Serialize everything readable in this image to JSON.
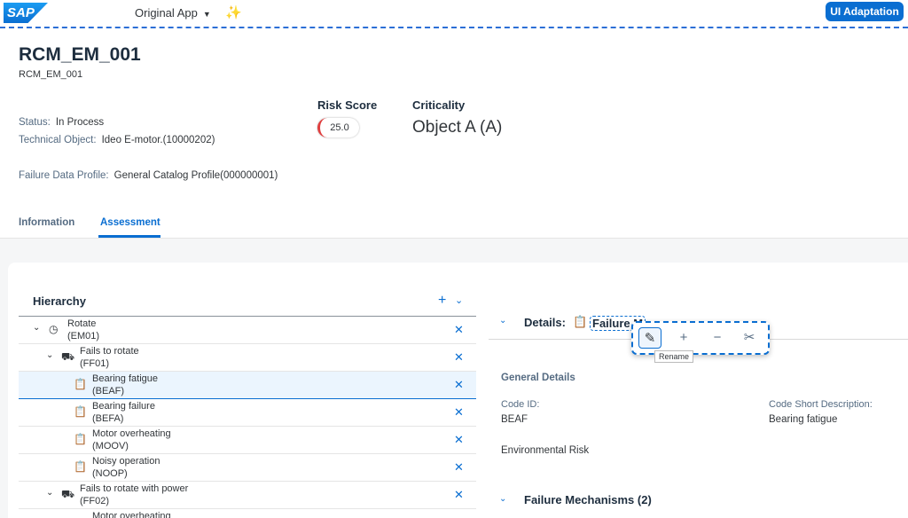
{
  "shell": {
    "logo": "SAP",
    "app_title": "Original App",
    "ui_adaptation": "UI Adaptation"
  },
  "header": {
    "title": "RCM_EM_001",
    "subtitle": "RCM_EM_001",
    "status_label": "Status:",
    "status_value": "In Process",
    "tech_obj_label": "Technical Object:",
    "tech_obj_value": "Ideo E-motor.(10000202)",
    "fdp_label": "Failure Data Profile:",
    "fdp_value": "General Catalog Profile(000000001)",
    "risk_score_label": "Risk Score",
    "risk_score_value": "25.0",
    "criticality_label": "Criticality",
    "criticality_value": "Object A (A)"
  },
  "tabs": [
    {
      "label": "Information",
      "active": false
    },
    {
      "label": "Assessment",
      "active": true
    }
  ],
  "hierarchy": {
    "title": "Hierarchy",
    "rows": [
      {
        "name": "Rotate",
        "code": "(EM01)",
        "level": 0,
        "icon": "gauge-icon",
        "expanded": true
      },
      {
        "name": "Fails to rotate",
        "code": "(FF01)",
        "level": 1,
        "icon": "car-icon",
        "expanded": true
      },
      {
        "name": "Bearing fatigue",
        "code": "(BEAF)",
        "level": 2,
        "icon": "clipboard-icon",
        "selected": true
      },
      {
        "name": "Bearing failure",
        "code": "(BEFA)",
        "level": 2,
        "icon": "clipboard-icon"
      },
      {
        "name": "Motor overheating",
        "code": "(MOOV)",
        "level": 2,
        "icon": "clipboard-icon"
      },
      {
        "name": "Noisy operation",
        "code": "(NOOP)",
        "level": 2,
        "icon": "clipboard-icon"
      },
      {
        "name": "Fails to rotate with power",
        "code": "(FF02)",
        "level": 1,
        "icon": "car-icon",
        "expanded": true
      },
      {
        "name": "Motor overheating",
        "code": "",
        "level": 2,
        "icon": "clipboard-icon"
      }
    ]
  },
  "details": {
    "title": "Details:",
    "subject": "Failure M",
    "tooltip": "Rename",
    "general_title": "General Details",
    "code_id_label": "Code ID:",
    "code_id_value": "BEAF",
    "code_short_label": "Code Short Description:",
    "code_short_value": "Bearing fatigue",
    "env_risk": "Environmental Risk",
    "mechanisms_title": "Failure Mechanisms (2)"
  }
}
